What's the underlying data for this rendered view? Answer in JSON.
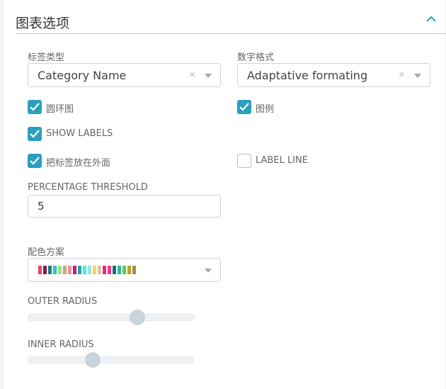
{
  "header": {
    "title": "图表选项",
    "collapse_icon": "chevron-up-icon"
  },
  "label_type": {
    "label": "标签类型",
    "value": "Category Name"
  },
  "number_format": {
    "label": "数字格式",
    "value": "Adaptative formating"
  },
  "clear_glyph": "×",
  "checkboxes": {
    "donut": {
      "label": "圆环图",
      "checked": true
    },
    "legend": {
      "label": "图例",
      "checked": true
    },
    "show_labels": {
      "label": "SHOW LABELS",
      "checked": true
    },
    "labels_outside": {
      "label": "把标签放在外面",
      "checked": true
    },
    "label_line": {
      "label": "LABEL LINE",
      "checked": false
    }
  },
  "percentage_threshold": {
    "label": "PERCENTAGE THRESHOLD",
    "value": "5"
  },
  "color_scheme": {
    "label": "配色方案",
    "colors": [
      "#e8455e",
      "#7b1f4f",
      "#1a7f7a",
      "#26c6c8",
      "#a3e07a",
      "#c8a878",
      "#f38aa0",
      "#c61a74",
      "#2aa3a8",
      "#42efe9",
      "#9ee3d8",
      "#f7d26a",
      "#d4c89a",
      "#e8278a",
      "#f2398f",
      "#1a6e6a",
      "#2fb5b0",
      "#53d33a",
      "#bfa02c",
      "#a88f4a"
    ]
  },
  "outer_radius": {
    "label": "OUTER RADIUS",
    "value": 0.66
  },
  "inner_radius": {
    "label": "INNER RADIUS",
    "value": 0.39
  },
  "accent_color": "#2a9fbf"
}
